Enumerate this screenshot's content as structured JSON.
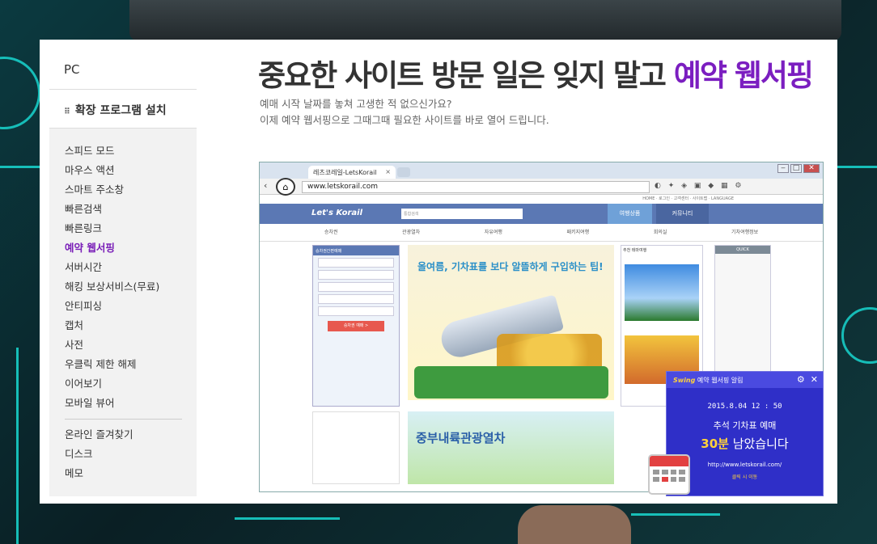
{
  "sidebar": {
    "pc_label": "PC",
    "ext_dots": "⠿",
    "ext_label": "확장 프로그램 설치",
    "items": [
      {
        "label": "스피드 모드"
      },
      {
        "label": "마우스 액션"
      },
      {
        "label": "스마트 주소창"
      },
      {
        "label": "빠른검색"
      },
      {
        "label": "빠른링크"
      },
      {
        "label": "예약 웹서핑"
      },
      {
        "label": "서버시간"
      },
      {
        "label": "해킹 보상서비스(무료)"
      },
      {
        "label": "안티피싱"
      },
      {
        "label": "캡처"
      },
      {
        "label": "사전"
      },
      {
        "label": "우클릭 제한 해제"
      },
      {
        "label": "이어보기"
      },
      {
        "label": "모바일 뷰어"
      }
    ],
    "items2": [
      {
        "label": "온라인 즐겨찾기"
      },
      {
        "label": "디스크"
      },
      {
        "label": "메모"
      }
    ]
  },
  "headline": {
    "main": "중요한 사이트 방문 일은 잊지 말고 ",
    "highlight": "예약 웹서핑"
  },
  "subtext": {
    "line1": "예매 시작 날짜를 놓쳐 고생한 적 없으신가요?",
    "line2": "이제 예약 웹서핑으로 그때그때 필요한 사이트를 바로 열어 드립니다."
  },
  "browser": {
    "tab_title": "레츠코레일-LetsKorail",
    "tab_close": "×",
    "url": "www.letskorail.com",
    "home_icon": "⌂",
    "back_icon": "‹",
    "forward_icon": "›",
    "win_min": "‒",
    "win_max": "□",
    "win_close": "✕",
    "toolbar_icons": "◐ ✦ ◈ ▣ ◆ ▦ ⚙",
    "site": {
      "top_links": "HOME · 로그인 · 고객센터 · 사이트맵 · LANGUAGE",
      "logo": "Let's Korail",
      "search_placeholder": "통합검색",
      "nav_tab1": "여행상품",
      "nav_tab2": "커뮤니티",
      "menu": [
        "승차권",
        "관광열차",
        "자유여행",
        "패키지여행",
        "회의실",
        "기차여행정보"
      ],
      "form_header": "승차권간편예매",
      "form_button": "승차권 예매 >",
      "banner_title": "올여름, 기차표를 보다 알뜰하게 구입하는 팁!",
      "theme_header": "추천 테마여행",
      "quick_header": "QUICK",
      "best_title": "중부내륙관광열차"
    }
  },
  "notify": {
    "brand": "Swing",
    "title": " 예약 웹서핑 알림",
    "gear_icon": "⚙",
    "close_icon": "✕",
    "time": "2015.8.04   12 : 50",
    "msg1": "추석 기차표 예매",
    "msg2_big": "30분",
    "msg2_rest": " 남았습니다",
    "url": "http://www.letskorail.com/",
    "link": "클릭 시 이동"
  }
}
